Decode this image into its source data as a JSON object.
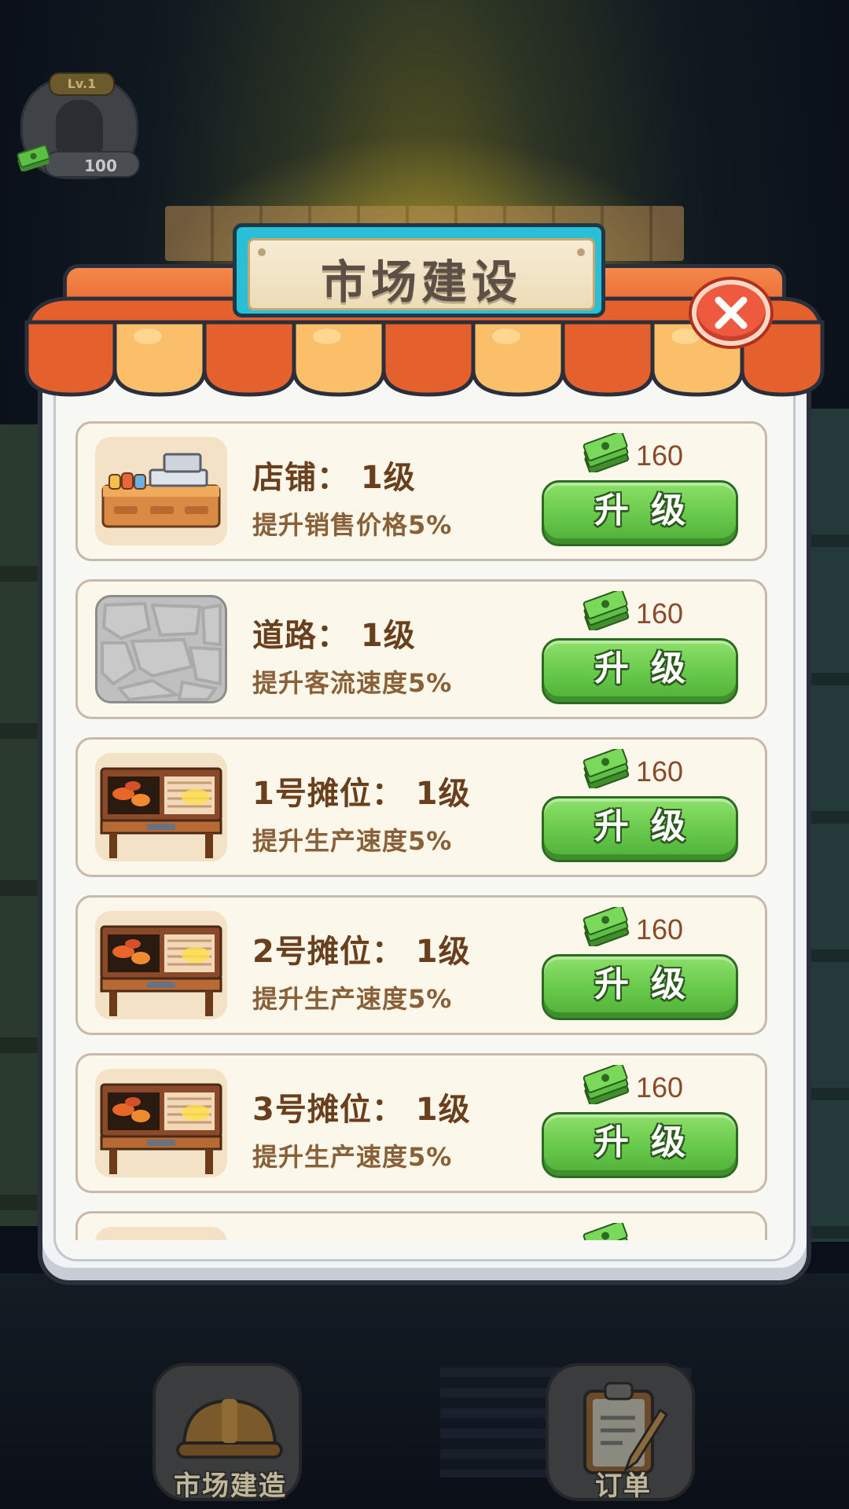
{
  "hud": {
    "level": "Lv.1",
    "coins": "100"
  },
  "dialog": {
    "title": "市场建设",
    "close_icon": "close-x-icon",
    "upgrade_label": "升级",
    "currency_icon": "cash-stack-icon",
    "items": [
      {
        "title": "店铺：  1级",
        "desc": "提升销售价格5%",
        "cost": "160",
        "icon": "shop-counter-icon"
      },
      {
        "title": "道路：  1级",
        "desc": "提升客流速度5%",
        "cost": "160",
        "icon": "stone-road-icon"
      },
      {
        "title": "1号摊位：  1级",
        "desc": "提升生产速度5%",
        "cost": "160",
        "icon": "grill-stall-icon"
      },
      {
        "title": "2号摊位：  1级",
        "desc": "提升生产速度5%",
        "cost": "160",
        "icon": "grill-stall-icon"
      },
      {
        "title": "3号摊位：  1级",
        "desc": "提升生产速度5%",
        "cost": "160",
        "icon": "grill-stall-icon"
      },
      {
        "title": "",
        "desc": "",
        "cost": "",
        "icon": "grill-stall-icon"
      }
    ]
  },
  "bottom_nav": {
    "build_label": "市场建造",
    "orders_label": "订单",
    "build_icon": "hard-hat-icon",
    "orders_icon": "clipboard-pencil-icon"
  },
  "colors": {
    "upgrade_green": "#66c84a",
    "awning_orange": "#e4602c",
    "sign_cyan": "#29bfd7",
    "close_red": "#ee5a40",
    "row_bg": "#fbf7ea"
  }
}
